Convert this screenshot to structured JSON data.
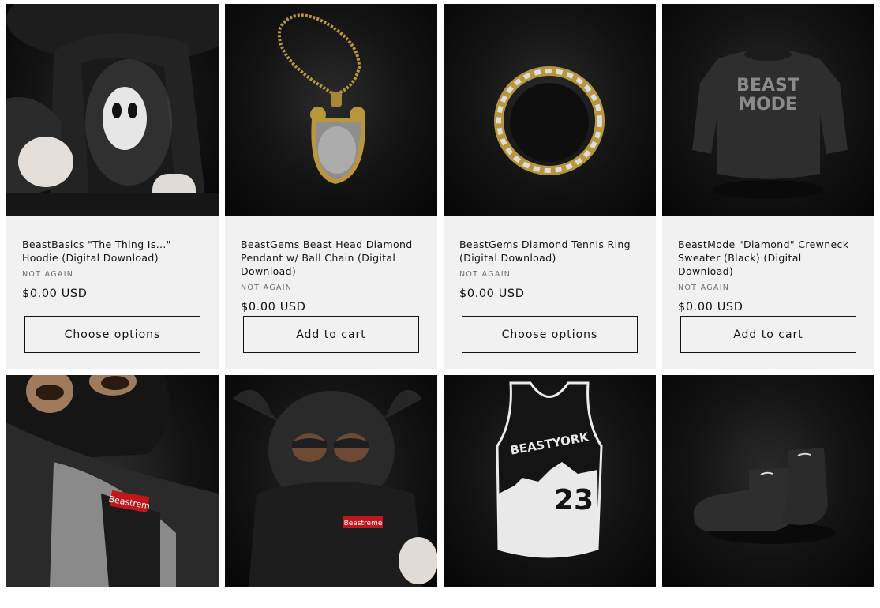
{
  "products": [
    {
      "title": "BeastBasics \"The Thing Is...\" Hoodie (Digital Download)",
      "vendor": "NOT AGAIN",
      "price": "$0.00 USD",
      "button": "Choose options",
      "image_icon": "hoodie-figure-image"
    },
    {
      "title": "BeastGems Beast Head Diamond Pendant w/ Ball Chain (Digital Download)",
      "vendor": "NOT AGAIN",
      "price": "$0.00 USD",
      "button": "Add to cart",
      "image_icon": "diamond-pendant-image"
    },
    {
      "title": "BeastGems Diamond Tennis Ring (Digital Download)",
      "vendor": "NOT AGAIN",
      "price": "$0.00 USD",
      "button": "Choose options",
      "image_icon": "tennis-ring-image"
    },
    {
      "title": "BeastMode \"Diamond\" Crewneck Sweater (Black) (Digital Download)",
      "vendor": "NOT AGAIN",
      "price": "$0.00 USD",
      "button": "Add to cart",
      "image_icon": "crewneck-sweater-image"
    }
  ],
  "row2": [
    {
      "image_icon": "masked-figure-vest-image",
      "label": "Beastrem"
    },
    {
      "image_icon": "horned-figure-image",
      "label": "Beastreme"
    },
    {
      "image_icon": "basketball-jersey-image",
      "label": "BEASTYORK",
      "number": "23"
    },
    {
      "image_icon": "socks-image"
    }
  ],
  "sweater_print": [
    "BEAST",
    "MODE"
  ],
  "colors": {
    "card_bg": "#f1f1f1",
    "text": "#121212",
    "muted": "#6f6f6f",
    "image_bg": "#111111"
  }
}
